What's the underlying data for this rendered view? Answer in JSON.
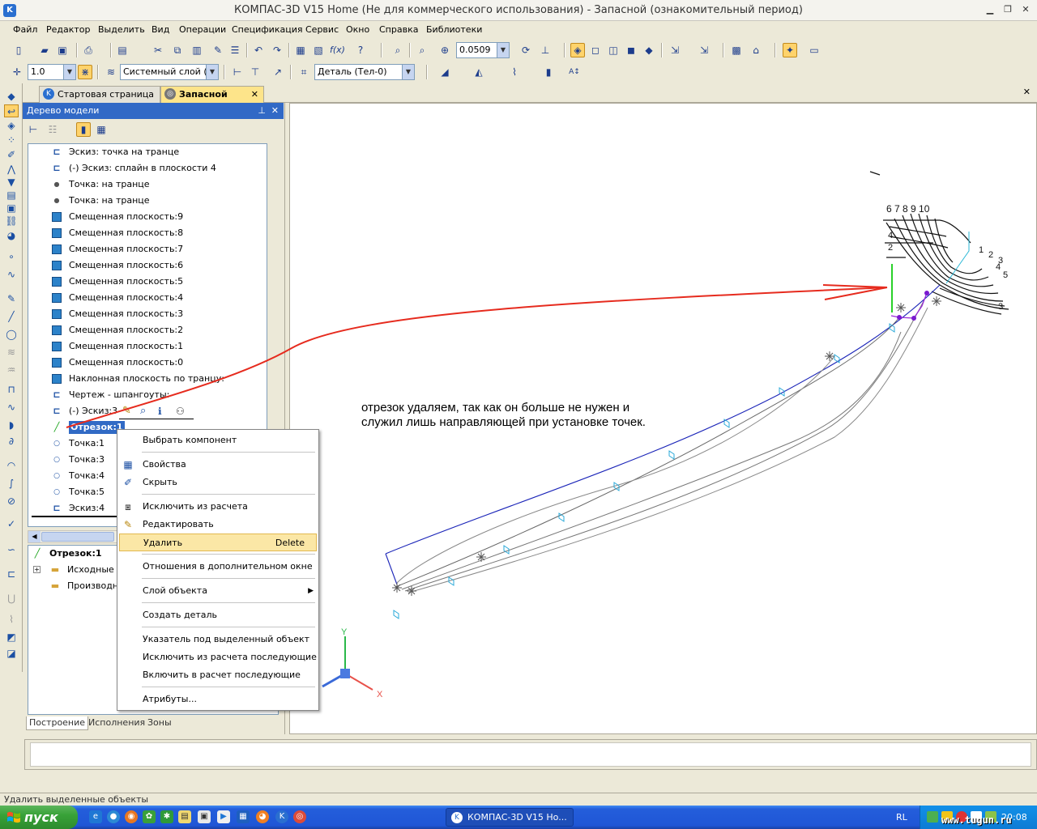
{
  "window": {
    "title": "КОМПАС-3D V15 Home (Не для коммерческого использования) - Запасной (ознакомительный период)"
  },
  "menu": [
    "Файл",
    "Редактор",
    "Выделить",
    "Вид",
    "Операции",
    "Спецификация",
    "Сервис",
    "Окно",
    "Справка",
    "Библиотеки"
  ],
  "toolbar": {
    "zoom_value": "0.0509",
    "line_step": "1.0",
    "layer": "Системный слой (0)",
    "detail": "Деталь (Тел-0)"
  },
  "doc_tabs": [
    {
      "label": "Стартовая страница",
      "active": false
    },
    {
      "label": "Запасной",
      "active": true
    }
  ],
  "panel": {
    "title": "Дерево модели",
    "tree": [
      {
        "icon": "sketch",
        "label": "Эскиз: точка на транце"
      },
      {
        "icon": "sketch",
        "label": "(-) Эскиз: сплайн  в плоскости 4"
      },
      {
        "icon": "point",
        "label": "Точка: на транце"
      },
      {
        "icon": "point",
        "label": "Точка: на транце"
      },
      {
        "icon": "plane",
        "label": "Смещенная плоскость:9"
      },
      {
        "icon": "plane",
        "label": "Смещенная плоскость:8"
      },
      {
        "icon": "plane",
        "label": "Смещенная плоскость:7"
      },
      {
        "icon": "plane",
        "label": "Смещенная плоскость:6"
      },
      {
        "icon": "plane",
        "label": "Смещенная плоскость:5"
      },
      {
        "icon": "plane",
        "label": "Смещенная плоскость:4"
      },
      {
        "icon": "plane",
        "label": "Смещенная плоскость:3"
      },
      {
        "icon": "plane",
        "label": "Смещенная плоскость:2"
      },
      {
        "icon": "plane",
        "label": "Смещенная плоскость:1"
      },
      {
        "icon": "plane",
        "label": "Смещенная плоскость:0"
      },
      {
        "icon": "plane",
        "label": "Наклонная плоскость по транцу:"
      },
      {
        "icon": "sketch",
        "label": "Чертеж -  шпангоуты:"
      },
      {
        "icon": "sketch",
        "label": "(-) Эскиз:3"
      },
      {
        "icon": "segment",
        "label": "Отрезок:1"
      },
      {
        "icon": "point",
        "label": "Точка:1"
      },
      {
        "icon": "point",
        "label": "Точка:3"
      },
      {
        "icon": "point",
        "label": "Точка:4"
      },
      {
        "icon": "point",
        "label": "Точка:5"
      },
      {
        "icon": "sketch",
        "label": "Эскиз:4"
      }
    ],
    "selected_index": 17,
    "props_title": "Отрезок:1",
    "props_children": [
      "Исходные с",
      "Производн"
    ],
    "bottom_tabs": [
      "Построение",
      "Исполнения",
      "Зоны"
    ]
  },
  "context_menu": [
    {
      "label": "Выбрать компонент"
    },
    {
      "sep": true
    },
    {
      "label": "Свойства",
      "icon": "properties-icon"
    },
    {
      "label": "Скрыть",
      "icon": "hide-icon"
    },
    {
      "sep": true
    },
    {
      "label": "Исключить из расчета",
      "icon": "exclude-icon"
    },
    {
      "label": "Редактировать",
      "icon": "pencil-icon"
    },
    {
      "label": "Удалить",
      "key": "Delete",
      "highlight": true
    },
    {
      "sep": true
    },
    {
      "label": "Отношения в дополнительном окне"
    },
    {
      "sep": true
    },
    {
      "label": "Слой объекта",
      "submenu": true
    },
    {
      "sep": true
    },
    {
      "label": "Создать деталь"
    },
    {
      "sep": true
    },
    {
      "label": "Указатель под выделенный объект"
    },
    {
      "label": "Исключить из расчета последующие"
    },
    {
      "label": "Включить в расчет последующие"
    },
    {
      "sep": true
    },
    {
      "label": "Атрибуты..."
    }
  ],
  "annotation": {
    "line1": "отрезок удаляем, так как он больше не нужен и",
    "line2": "служил лишь направляющей при установке точек."
  },
  "drawing": {
    "frame_labels_top": "6 7 8 9 10",
    "frame_labels_right": [
      "1",
      "2",
      "3",
      "4",
      "5"
    ],
    "frame_labels_left": [
      "4",
      "2"
    ],
    "frame_label_bottom": "3",
    "axis_x": "X",
    "axis_y": "Y"
  },
  "status": "Удалить выделенные объекты",
  "taskbar": {
    "start": "пуск",
    "app": "КОМПАС-3D V15 Ho...",
    "lang": "RL",
    "clock": "20:08",
    "watermark": "www.tugun.ru"
  }
}
